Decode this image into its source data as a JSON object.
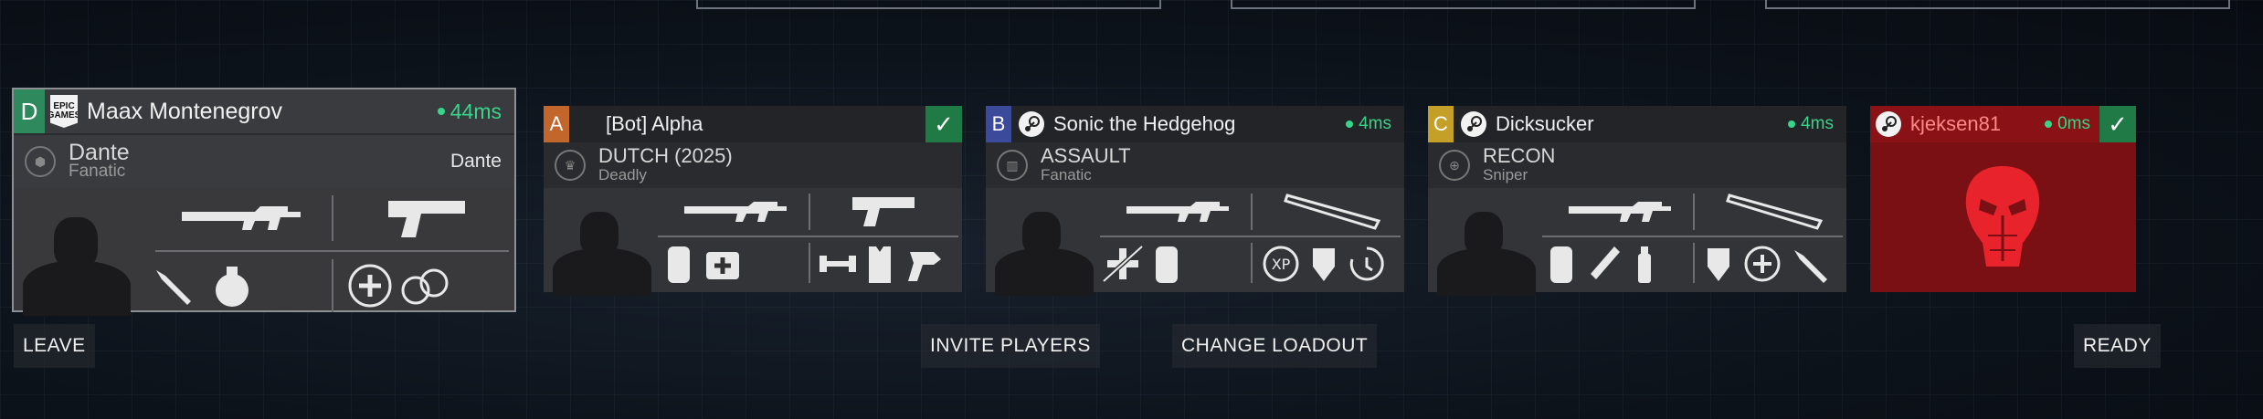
{
  "players": [
    {
      "slot": "D",
      "slot_color": "#2e8a5c",
      "platform": "epic-games-icon",
      "platform_label": "EPIC\nGAMES",
      "name": "Maax Montenegrov",
      "ping": "44ms",
      "class_name": "Dante",
      "class_sub": "Fanatic",
      "class_right": "Dante",
      "ready": false
    },
    {
      "slot": "A",
      "slot_color": "#c2662c",
      "platform": "",
      "name": "[Bot] Alpha",
      "ping": "",
      "class_name": "DUTCH (2025)",
      "class_sub": "Deadly",
      "ready": true
    },
    {
      "slot": "B",
      "slot_color": "#3c4a9c",
      "platform": "steam-icon",
      "name": "Sonic the Hedgehog",
      "ping": "4ms",
      "class_name": "ASSAULT",
      "class_sub": "Fanatic",
      "ready": false
    },
    {
      "slot": "C",
      "slot_color": "#c4a028",
      "platform": "steam-icon",
      "name": "Dicksucker",
      "ping": "4ms",
      "class_name": "RECON",
      "class_sub": "Sniper",
      "ready": false
    },
    {
      "slot": "",
      "platform": "steam-icon",
      "name": "kjeksen81",
      "ping": "0ms",
      "ready": true,
      "role_icon": "predator-mask-icon"
    }
  ],
  "buttons": {
    "leave": "LEAVE",
    "invite": "INVITE PLAYERS",
    "change_loadout": "CHANGE LOADOUT",
    "ready": "READY"
  },
  "glyphs": {
    "check": "✓",
    "xp": "XP",
    "plus": "+"
  }
}
